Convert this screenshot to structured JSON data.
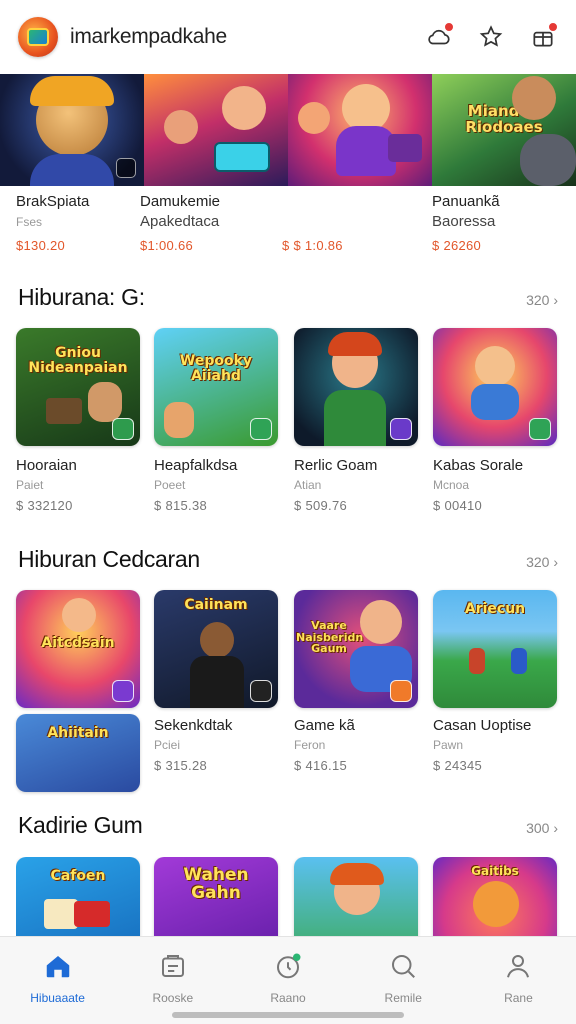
{
  "header": {
    "title": "imarkempadkahe",
    "icons": [
      "cloud-alert-icon",
      "star-outline-icon",
      "gift-icon"
    ],
    "logo": "app-logo"
  },
  "banners": [
    {
      "label": "",
      "name1": "BrakSpiata",
      "name2": "Fses",
      "price": "$130.20"
    },
    {
      "label": "",
      "name1": "Damukemie",
      "name2": "Apakedtaca",
      "price": "$1:00.66"
    },
    {
      "label": "",
      "name1": "",
      "name2": "",
      "price": "$ $ 1:0.86"
    },
    {
      "label": "Mianden Riodoaes",
      "name1": "Panuankã",
      "name2": "Baoressa",
      "price": "$ 26260"
    }
  ],
  "sections": [
    {
      "title": "Hiburana: G:",
      "more": "320 ›",
      "items": [
        {
          "label": "Gniou Nideanpaian",
          "name": "Hooraian",
          "sub": "Paiet",
          "price": "$ 332120"
        },
        {
          "label": "Wepooky Aiiahd",
          "name": "Heapfalkdsa",
          "sub": "Poeet",
          "price": "$ 815.38"
        },
        {
          "label": "",
          "name": "Rerlic Goam",
          "sub": "Atian",
          "price": "$ 509.76"
        },
        {
          "label": "",
          "name": "Kabas Sorale",
          "sub": "Mcnoa",
          "price": "$ 00410"
        }
      ]
    },
    {
      "title": "Hiburan Cedcaran",
      "more": "320 ›",
      "items": [
        {
          "label": "Aitcdsain",
          "name": "Sekenkdtak",
          "sub": "Pciei",
          "price": "$ 315.28"
        },
        {
          "label": "Caiinam",
          "name": "Game kã",
          "sub": "Feron",
          "price": "$ 416.15"
        },
        {
          "label": "Vaare Naisberidn Gaum",
          "name": "Casan Uoptise",
          "sub": "Pawn",
          "price": "$ 24345"
        },
        {
          "label": "Ariecun",
          "name": "",
          "sub": "",
          "price": ""
        }
      ],
      "extra_tile_label": "Ahiitain"
    },
    {
      "title": "Kadirie Gum",
      "more": "300 ›",
      "items": [
        {
          "label": "Cafoen",
          "name": "",
          "sub": "",
          "price": ""
        },
        {
          "label": "Wahen Gahn",
          "name": "",
          "sub": "",
          "price": ""
        },
        {
          "label": "",
          "name": "",
          "sub": "",
          "price": ""
        },
        {
          "label": "Gaitibs",
          "name": "",
          "sub": "",
          "price": ""
        }
      ]
    }
  ],
  "nav": [
    {
      "label": "Hibuaaate",
      "icon": "home-icon",
      "active": true
    },
    {
      "label": "Rooske",
      "icon": "store-icon",
      "active": false
    },
    {
      "label": "Raano",
      "icon": "compass-icon",
      "active": false
    },
    {
      "label": "Remile",
      "icon": "search-icon",
      "active": false
    },
    {
      "label": "Rane",
      "icon": "profile-icon",
      "active": false
    }
  ],
  "colors": {
    "accent": "#1e6bd6",
    "price_orange": "#e2572b",
    "alert": "#e53935"
  }
}
